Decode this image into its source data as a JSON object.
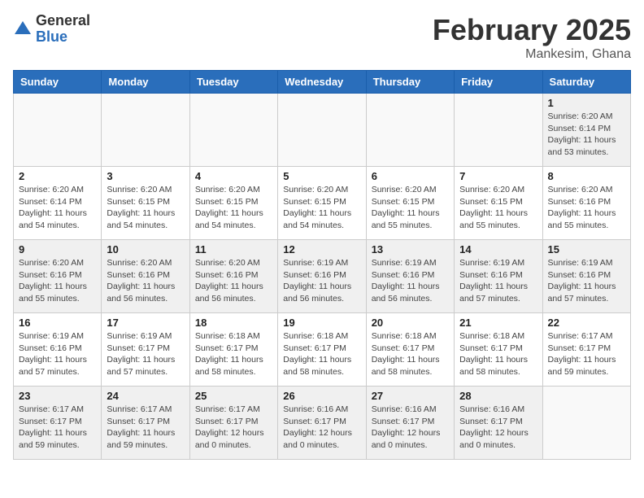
{
  "header": {
    "logo_general": "General",
    "logo_blue": "Blue",
    "title": "February 2025",
    "subtitle": "Mankesim, Ghana"
  },
  "weekdays": [
    "Sunday",
    "Monday",
    "Tuesday",
    "Wednesday",
    "Thursday",
    "Friday",
    "Saturday"
  ],
  "weeks": [
    [
      {
        "day": "",
        "info": ""
      },
      {
        "day": "",
        "info": ""
      },
      {
        "day": "",
        "info": ""
      },
      {
        "day": "",
        "info": ""
      },
      {
        "day": "",
        "info": ""
      },
      {
        "day": "",
        "info": ""
      },
      {
        "day": "1",
        "info": "Sunrise: 6:20 AM\nSunset: 6:14 PM\nDaylight: 11 hours\nand 53 minutes."
      }
    ],
    [
      {
        "day": "2",
        "info": "Sunrise: 6:20 AM\nSunset: 6:14 PM\nDaylight: 11 hours\nand 54 minutes."
      },
      {
        "day": "3",
        "info": "Sunrise: 6:20 AM\nSunset: 6:15 PM\nDaylight: 11 hours\nand 54 minutes."
      },
      {
        "day": "4",
        "info": "Sunrise: 6:20 AM\nSunset: 6:15 PM\nDaylight: 11 hours\nand 54 minutes."
      },
      {
        "day": "5",
        "info": "Sunrise: 6:20 AM\nSunset: 6:15 PM\nDaylight: 11 hours\nand 54 minutes."
      },
      {
        "day": "6",
        "info": "Sunrise: 6:20 AM\nSunset: 6:15 PM\nDaylight: 11 hours\nand 55 minutes."
      },
      {
        "day": "7",
        "info": "Sunrise: 6:20 AM\nSunset: 6:15 PM\nDaylight: 11 hours\nand 55 minutes."
      },
      {
        "day": "8",
        "info": "Sunrise: 6:20 AM\nSunset: 6:16 PM\nDaylight: 11 hours\nand 55 minutes."
      }
    ],
    [
      {
        "day": "9",
        "info": "Sunrise: 6:20 AM\nSunset: 6:16 PM\nDaylight: 11 hours\nand 55 minutes."
      },
      {
        "day": "10",
        "info": "Sunrise: 6:20 AM\nSunset: 6:16 PM\nDaylight: 11 hours\nand 56 minutes."
      },
      {
        "day": "11",
        "info": "Sunrise: 6:20 AM\nSunset: 6:16 PM\nDaylight: 11 hours\nand 56 minutes."
      },
      {
        "day": "12",
        "info": "Sunrise: 6:19 AM\nSunset: 6:16 PM\nDaylight: 11 hours\nand 56 minutes."
      },
      {
        "day": "13",
        "info": "Sunrise: 6:19 AM\nSunset: 6:16 PM\nDaylight: 11 hours\nand 56 minutes."
      },
      {
        "day": "14",
        "info": "Sunrise: 6:19 AM\nSunset: 6:16 PM\nDaylight: 11 hours\nand 57 minutes."
      },
      {
        "day": "15",
        "info": "Sunrise: 6:19 AM\nSunset: 6:16 PM\nDaylight: 11 hours\nand 57 minutes."
      }
    ],
    [
      {
        "day": "16",
        "info": "Sunrise: 6:19 AM\nSunset: 6:16 PM\nDaylight: 11 hours\nand 57 minutes."
      },
      {
        "day": "17",
        "info": "Sunrise: 6:19 AM\nSunset: 6:17 PM\nDaylight: 11 hours\nand 57 minutes."
      },
      {
        "day": "18",
        "info": "Sunrise: 6:18 AM\nSunset: 6:17 PM\nDaylight: 11 hours\nand 58 minutes."
      },
      {
        "day": "19",
        "info": "Sunrise: 6:18 AM\nSunset: 6:17 PM\nDaylight: 11 hours\nand 58 minutes."
      },
      {
        "day": "20",
        "info": "Sunrise: 6:18 AM\nSunset: 6:17 PM\nDaylight: 11 hours\nand 58 minutes."
      },
      {
        "day": "21",
        "info": "Sunrise: 6:18 AM\nSunset: 6:17 PM\nDaylight: 11 hours\nand 58 minutes."
      },
      {
        "day": "22",
        "info": "Sunrise: 6:17 AM\nSunset: 6:17 PM\nDaylight: 11 hours\nand 59 minutes."
      }
    ],
    [
      {
        "day": "23",
        "info": "Sunrise: 6:17 AM\nSunset: 6:17 PM\nDaylight: 11 hours\nand 59 minutes."
      },
      {
        "day": "24",
        "info": "Sunrise: 6:17 AM\nSunset: 6:17 PM\nDaylight: 11 hours\nand 59 minutes."
      },
      {
        "day": "25",
        "info": "Sunrise: 6:17 AM\nSunset: 6:17 PM\nDaylight: 12 hours\nand 0 minutes."
      },
      {
        "day": "26",
        "info": "Sunrise: 6:16 AM\nSunset: 6:17 PM\nDaylight: 12 hours\nand 0 minutes."
      },
      {
        "day": "27",
        "info": "Sunrise: 6:16 AM\nSunset: 6:17 PM\nDaylight: 12 hours\nand 0 minutes."
      },
      {
        "day": "28",
        "info": "Sunrise: 6:16 AM\nSunset: 6:17 PM\nDaylight: 12 hours\nand 0 minutes."
      },
      {
        "day": "",
        "info": ""
      }
    ]
  ]
}
